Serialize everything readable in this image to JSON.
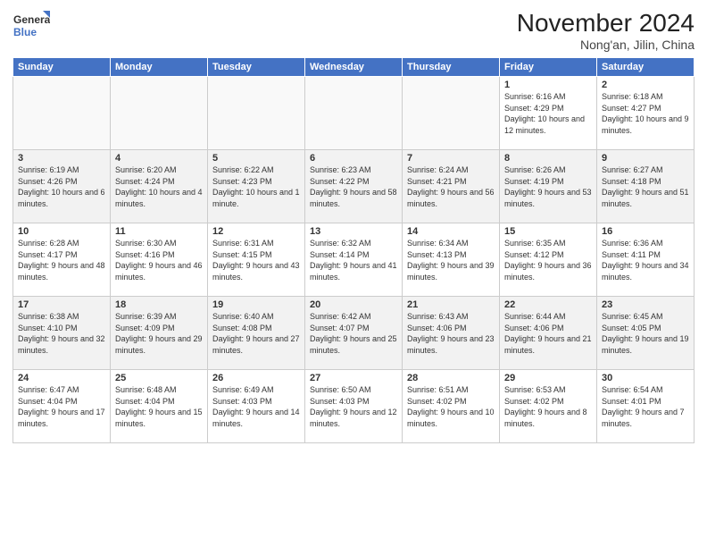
{
  "header": {
    "logo_line1": "General",
    "logo_line2": "Blue",
    "month": "November 2024",
    "location": "Nong'an, Jilin, China"
  },
  "weekdays": [
    "Sunday",
    "Monday",
    "Tuesday",
    "Wednesday",
    "Thursday",
    "Friday",
    "Saturday"
  ],
  "weeks": [
    [
      {
        "day": "",
        "info": ""
      },
      {
        "day": "",
        "info": ""
      },
      {
        "day": "",
        "info": ""
      },
      {
        "day": "",
        "info": ""
      },
      {
        "day": "",
        "info": ""
      },
      {
        "day": "1",
        "info": "Sunrise: 6:16 AM\nSunset: 4:29 PM\nDaylight: 10 hours and 12 minutes."
      },
      {
        "day": "2",
        "info": "Sunrise: 6:18 AM\nSunset: 4:27 PM\nDaylight: 10 hours and 9 minutes."
      }
    ],
    [
      {
        "day": "3",
        "info": "Sunrise: 6:19 AM\nSunset: 4:26 PM\nDaylight: 10 hours and 6 minutes."
      },
      {
        "day": "4",
        "info": "Sunrise: 6:20 AM\nSunset: 4:24 PM\nDaylight: 10 hours and 4 minutes."
      },
      {
        "day": "5",
        "info": "Sunrise: 6:22 AM\nSunset: 4:23 PM\nDaylight: 10 hours and 1 minute."
      },
      {
        "day": "6",
        "info": "Sunrise: 6:23 AM\nSunset: 4:22 PM\nDaylight: 9 hours and 58 minutes."
      },
      {
        "day": "7",
        "info": "Sunrise: 6:24 AM\nSunset: 4:21 PM\nDaylight: 9 hours and 56 minutes."
      },
      {
        "day": "8",
        "info": "Sunrise: 6:26 AM\nSunset: 4:19 PM\nDaylight: 9 hours and 53 minutes."
      },
      {
        "day": "9",
        "info": "Sunrise: 6:27 AM\nSunset: 4:18 PM\nDaylight: 9 hours and 51 minutes."
      }
    ],
    [
      {
        "day": "10",
        "info": "Sunrise: 6:28 AM\nSunset: 4:17 PM\nDaylight: 9 hours and 48 minutes."
      },
      {
        "day": "11",
        "info": "Sunrise: 6:30 AM\nSunset: 4:16 PM\nDaylight: 9 hours and 46 minutes."
      },
      {
        "day": "12",
        "info": "Sunrise: 6:31 AM\nSunset: 4:15 PM\nDaylight: 9 hours and 43 minutes."
      },
      {
        "day": "13",
        "info": "Sunrise: 6:32 AM\nSunset: 4:14 PM\nDaylight: 9 hours and 41 minutes."
      },
      {
        "day": "14",
        "info": "Sunrise: 6:34 AM\nSunset: 4:13 PM\nDaylight: 9 hours and 39 minutes."
      },
      {
        "day": "15",
        "info": "Sunrise: 6:35 AM\nSunset: 4:12 PM\nDaylight: 9 hours and 36 minutes."
      },
      {
        "day": "16",
        "info": "Sunrise: 6:36 AM\nSunset: 4:11 PM\nDaylight: 9 hours and 34 minutes."
      }
    ],
    [
      {
        "day": "17",
        "info": "Sunrise: 6:38 AM\nSunset: 4:10 PM\nDaylight: 9 hours and 32 minutes."
      },
      {
        "day": "18",
        "info": "Sunrise: 6:39 AM\nSunset: 4:09 PM\nDaylight: 9 hours and 29 minutes."
      },
      {
        "day": "19",
        "info": "Sunrise: 6:40 AM\nSunset: 4:08 PM\nDaylight: 9 hours and 27 minutes."
      },
      {
        "day": "20",
        "info": "Sunrise: 6:42 AM\nSunset: 4:07 PM\nDaylight: 9 hours and 25 minutes."
      },
      {
        "day": "21",
        "info": "Sunrise: 6:43 AM\nSunset: 4:06 PM\nDaylight: 9 hours and 23 minutes."
      },
      {
        "day": "22",
        "info": "Sunrise: 6:44 AM\nSunset: 4:06 PM\nDaylight: 9 hours and 21 minutes."
      },
      {
        "day": "23",
        "info": "Sunrise: 6:45 AM\nSunset: 4:05 PM\nDaylight: 9 hours and 19 minutes."
      }
    ],
    [
      {
        "day": "24",
        "info": "Sunrise: 6:47 AM\nSunset: 4:04 PM\nDaylight: 9 hours and 17 minutes."
      },
      {
        "day": "25",
        "info": "Sunrise: 6:48 AM\nSunset: 4:04 PM\nDaylight: 9 hours and 15 minutes."
      },
      {
        "day": "26",
        "info": "Sunrise: 6:49 AM\nSunset: 4:03 PM\nDaylight: 9 hours and 14 minutes."
      },
      {
        "day": "27",
        "info": "Sunrise: 6:50 AM\nSunset: 4:03 PM\nDaylight: 9 hours and 12 minutes."
      },
      {
        "day": "28",
        "info": "Sunrise: 6:51 AM\nSunset: 4:02 PM\nDaylight: 9 hours and 10 minutes."
      },
      {
        "day": "29",
        "info": "Sunrise: 6:53 AM\nSunset: 4:02 PM\nDaylight: 9 hours and 8 minutes."
      },
      {
        "day": "30",
        "info": "Sunrise: 6:54 AM\nSunset: 4:01 PM\nDaylight: 9 hours and 7 minutes."
      }
    ]
  ]
}
